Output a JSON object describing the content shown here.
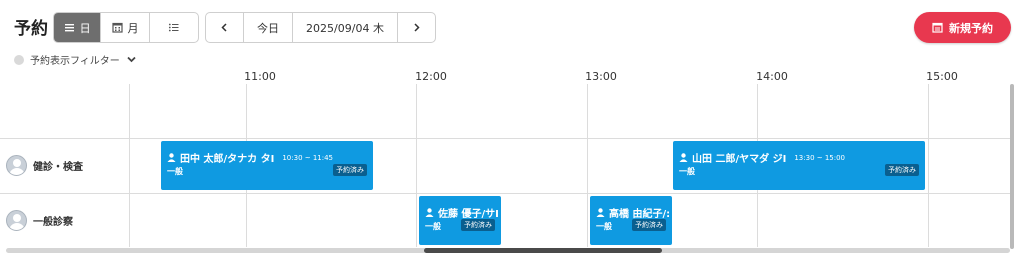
{
  "header": {
    "title": "予約",
    "view_buttons": [
      {
        "icon": "list-lines-icon",
        "label": "日",
        "active": true
      },
      {
        "icon": "calendar-grid-icon",
        "label": "月",
        "active": false
      },
      {
        "icon": "bullet-list-icon",
        "label": "",
        "active": false
      }
    ],
    "nav": {
      "prev_icon": "chevron-left-icon",
      "today_label": "今日",
      "date_label": "2025/09/04 木",
      "next_icon": "chevron-right-icon"
    },
    "new_button": {
      "icon": "calendar-icon",
      "label": "新規予約",
      "color": "#e8384f"
    }
  },
  "filter": {
    "label": "予約表示フィルター",
    "icon": "chevron-down-icon"
  },
  "timeline": {
    "hours": [
      "11:00",
      "12:00",
      "13:00",
      "14:00",
      "15:00"
    ],
    "resources": [
      {
        "name": "健診・検査",
        "icon": "avatar"
      },
      {
        "name": "一般診察",
        "icon": "avatar"
      }
    ]
  },
  "appointments": [
    {
      "resource": "健診・検査",
      "name": "田中 太郎/タナカ タI",
      "time": "10:30 ~ 11:45",
      "type": "一般",
      "status": "予約済み"
    },
    {
      "resource": "健診・検査",
      "name": "山田 二郎/ヤマダ ジI",
      "time": "13:30 ~ 15:00",
      "type": "一般",
      "status": "予約済み"
    },
    {
      "resource": "一般診察",
      "name": "佐藤 優子/サI",
      "time": "",
      "type": "一般",
      "status": "予約済み"
    },
    {
      "resource": "一般診察",
      "name": "高橋 由紀子/:",
      "time": "",
      "type": "一般",
      "status": "予約済み"
    }
  ],
  "colors": {
    "appointment": "#0f9ae1",
    "badge": "#0a5f8f",
    "accent": "#e8384f"
  }
}
